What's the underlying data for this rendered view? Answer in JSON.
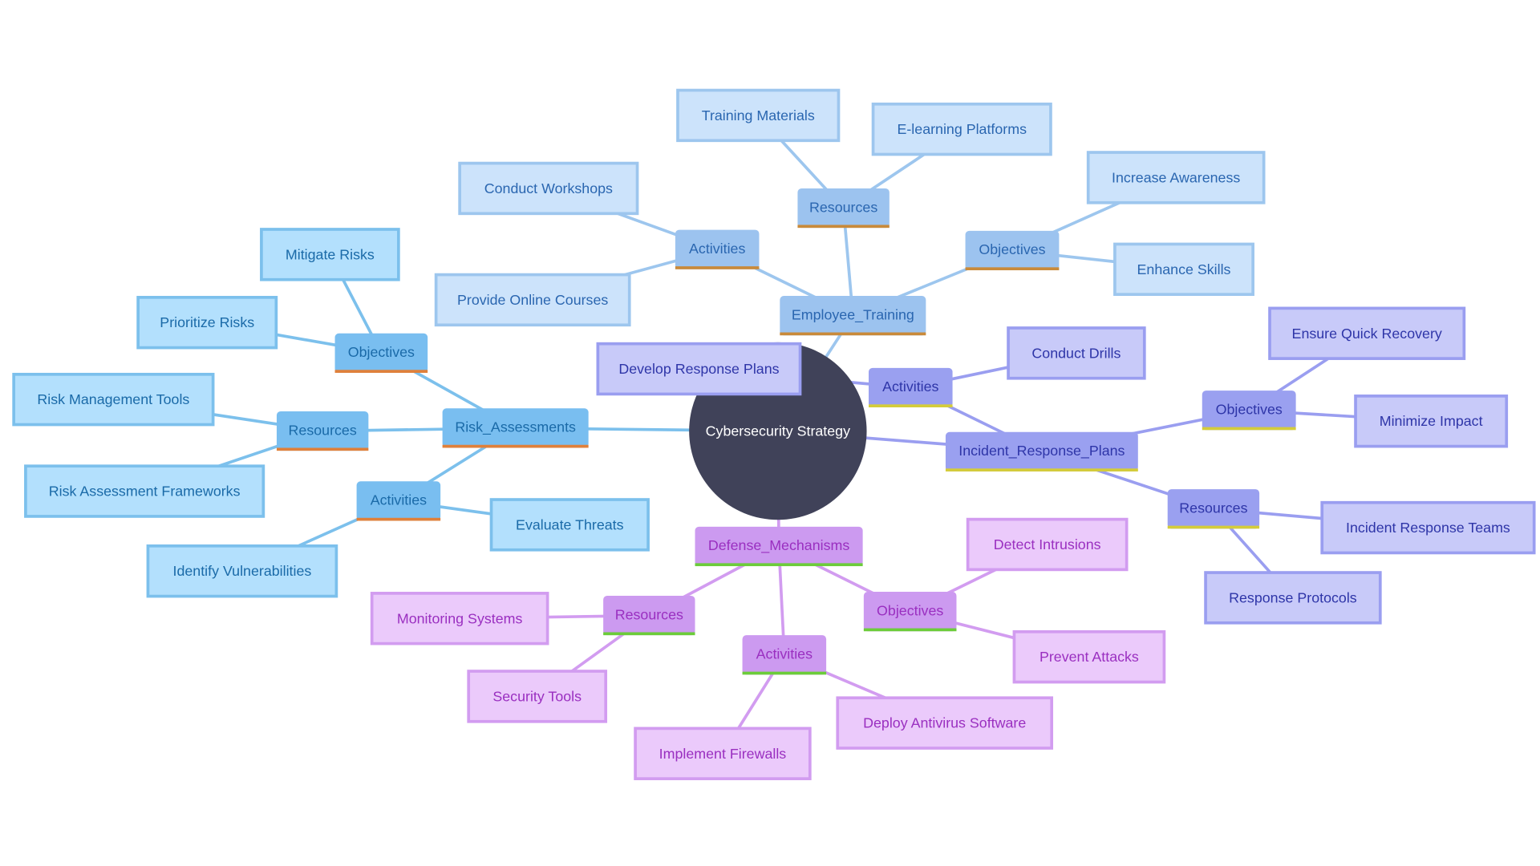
{
  "title": "Cybersecurity Strategy",
  "root": {
    "label": "Cybersecurity Strategy",
    "color": "#404259"
  },
  "branches": [
    {
      "key": "risk",
      "label": "Risk_Assessments",
      "colors": {
        "leaf_fill": "#b3e0fd",
        "leaf_border": "#7cc0ec",
        "text": "#1a6aa8",
        "mid_fill": "#79bef0",
        "underline": "#e0803a",
        "edge": "#7cc0ec"
      },
      "groups": [
        {
          "label": "Objectives",
          "items": [
            "Mitigate Risks",
            "Prioritize Risks"
          ]
        },
        {
          "label": "Resources",
          "items": [
            "Risk Management Tools",
            "Risk Assessment Frameworks"
          ]
        },
        {
          "label": "Activities",
          "items": [
            "Evaluate Threats",
            "Identify Vulnerabilities"
          ]
        }
      ]
    },
    {
      "key": "training",
      "label": "Employee_Training",
      "colors": {
        "leaf_fill": "#cce3fb",
        "leaf_border": "#9dc6ee",
        "text": "#2a66b0",
        "mid_fill": "#9cc3ef",
        "underline": "#c98a3a",
        "edge": "#9dc6ee"
      },
      "groups": [
        {
          "label": "Activities",
          "items": [
            "Conduct Workshops",
            "Provide Online Courses"
          ]
        },
        {
          "label": "Resources",
          "items": [
            "Training Materials",
            "E-learning Platforms"
          ]
        },
        {
          "label": "Objectives",
          "items": [
            "Increase Awareness",
            "Enhance Skills"
          ]
        }
      ]
    },
    {
      "key": "incident",
      "label": "Incident_Response_Plans",
      "colors": {
        "leaf_fill": "#c8caf9",
        "leaf_border": "#9a9ef0",
        "text": "#2e35a8",
        "mid_fill": "#9aa0f0",
        "underline": "#d4cc3a",
        "edge": "#9a9ef0"
      },
      "groups": [
        {
          "label": "Activities",
          "items": [
            "Conduct Drills",
            "Develop Response Plans"
          ]
        },
        {
          "label": "Objectives",
          "items": [
            "Ensure Quick Recovery",
            "Minimize Impact"
          ]
        },
        {
          "label": "Resources",
          "items": [
            "Incident Response Teams",
            "Response Protocols"
          ]
        }
      ]
    },
    {
      "key": "defense",
      "label": "Defense_Mechanisms",
      "colors": {
        "leaf_fill": "#ebcafb",
        "leaf_border": "#d29cf0",
        "text": "#9a2fc0",
        "mid_fill": "#cc9af0",
        "underline": "#6ccc3a",
        "edge": "#d29cf0"
      },
      "groups": [
        {
          "label": "Resources",
          "items": [
            "Monitoring Systems",
            "Security Tools"
          ]
        },
        {
          "label": "Activities",
          "items": [
            "Implement Firewalls",
            "Deploy Antivirus Software"
          ]
        },
        {
          "label": "Objectives",
          "items": [
            "Detect Intrusions",
            "Prevent Attacks"
          ]
        }
      ]
    }
  ]
}
